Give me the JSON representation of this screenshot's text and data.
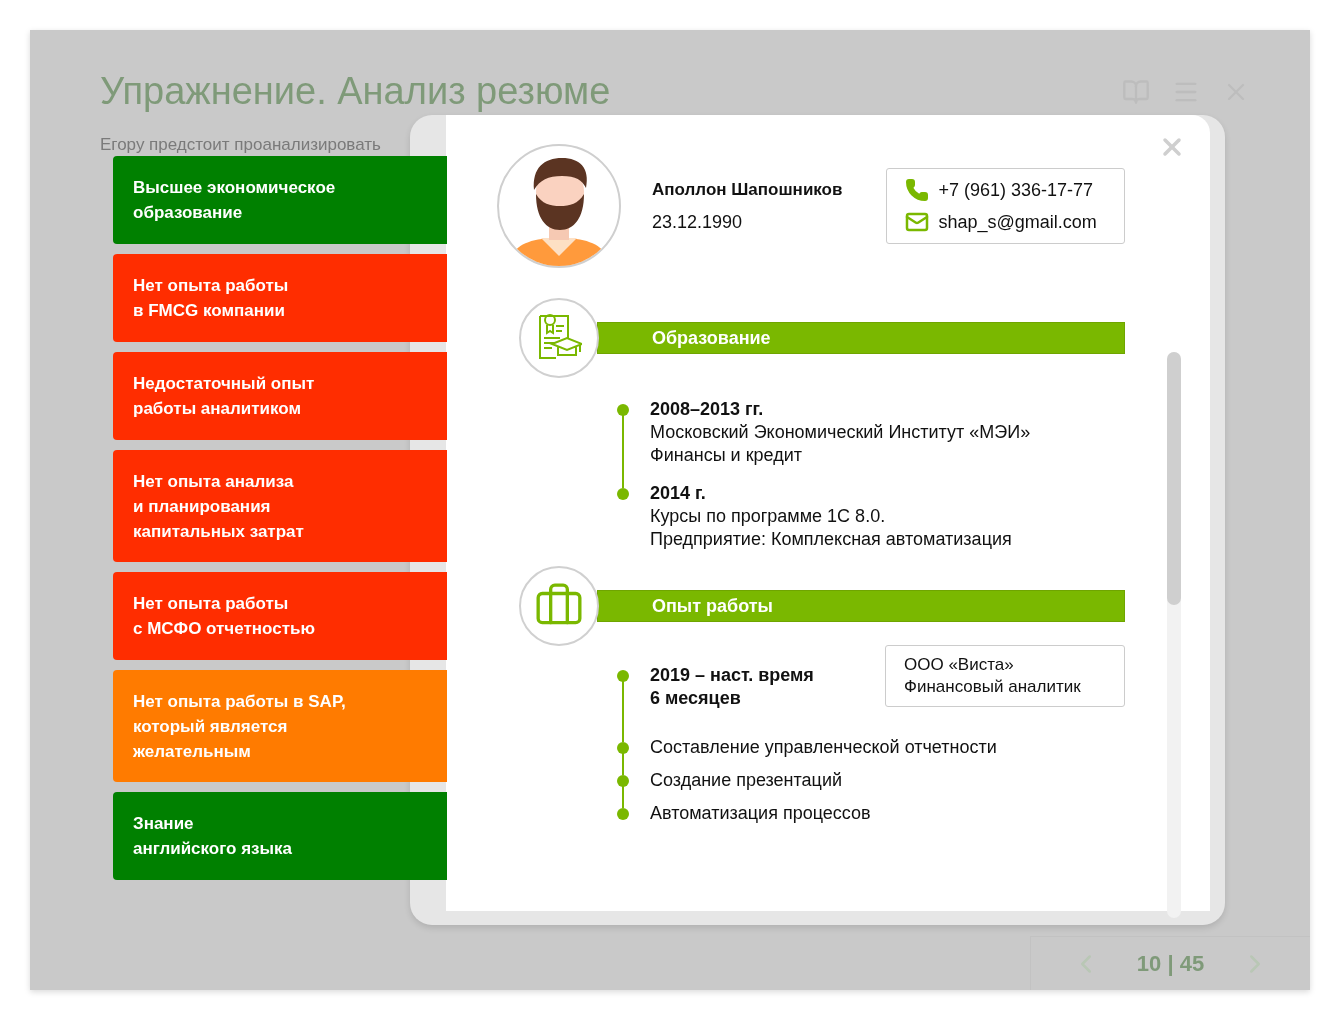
{
  "slide": {
    "title": "Упражнение. Анализ резюме",
    "intro": "Егору предстоит проанализировать",
    "pager": "10 | 45"
  },
  "criteria": [
    {
      "text": "Высшее экономическое\nобразование",
      "color": "#008000"
    },
    {
      "text": "Нет опыта работы\nв FMCG компании",
      "color": "#ff2d00"
    },
    {
      "text": "Недостаточный опыт\nработы аналитиком",
      "color": "#ff2d00"
    },
    {
      "text": "Нет опыта анализа\nи планирования\nкапитальных затрат",
      "color": "#ff2d00"
    },
    {
      "text": "Нет опыта работы\nс МСФО отчетностью",
      "color": "#ff2d00"
    },
    {
      "text": "Нет опыта работы в SAP,\nкоторый является\nжелательным",
      "color": "#ff7b00"
    },
    {
      "text": "Знание\nанглийского языка",
      "color": "#008000"
    }
  ],
  "resume": {
    "name": "Аполлон Шапошников",
    "birth_date": "23.12.1990",
    "phone": "+7 (961) 336-17-77",
    "email": "shap_s@gmail.com",
    "sections": [
      {
        "kind": "education",
        "title": "Образование",
        "entries": [
          {
            "kind": "period",
            "title": "2008–2013 гг.",
            "lines": [
              "Московский Экономический Институт «МЭИ»",
              "Финансы и кредит"
            ]
          },
          {
            "kind": "period",
            "title": "2014 г.",
            "lines": [
              "Курсы по программе 1С 8.0.",
              "Предприятие: Комплексная автоматизация"
            ]
          }
        ]
      },
      {
        "kind": "work",
        "title": "Опыт работы",
        "entries": [
          {
            "kind": "job",
            "title": "2019 – наст. время",
            "duration": "6 месяцев",
            "company": "ООО «Виста»",
            "position": "Финансовый аналитик"
          },
          {
            "kind": "task",
            "title": "Составление управленческой отчетности"
          },
          {
            "kind": "task",
            "title": "Создание презентаций"
          },
          {
            "kind": "task",
            "title": "Автоматизация процессов"
          }
        ]
      }
    ]
  }
}
